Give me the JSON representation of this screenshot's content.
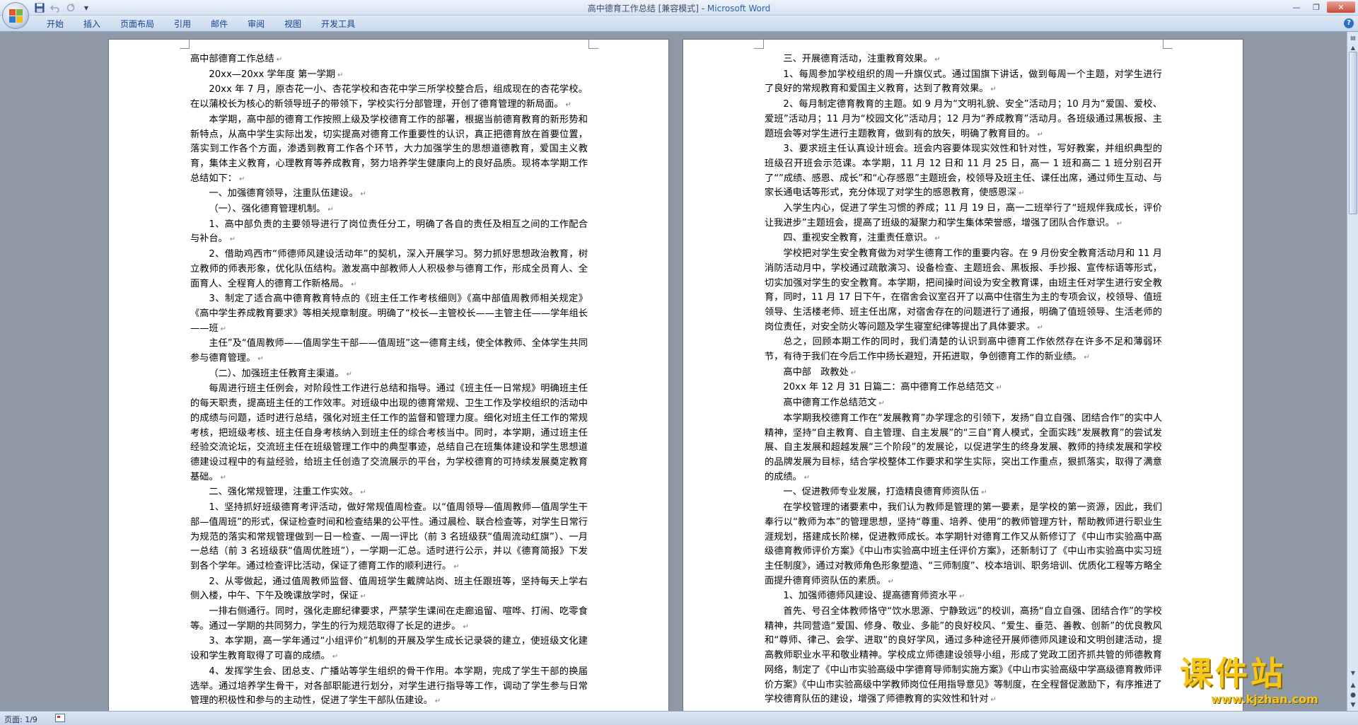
{
  "window": {
    "title": "高中德育工作总结 [兼容模式] - ",
    "app_name": "Microsoft Word"
  },
  "quick_access": [
    "save-icon",
    "undo-icon",
    "redo-icon",
    "customize-dropdown-icon"
  ],
  "ribbon": {
    "tabs": [
      "开始",
      "插入",
      "页面布局",
      "引用",
      "邮件",
      "审阅",
      "视图",
      "开发工具"
    ]
  },
  "status": {
    "page": "页面: 1/9"
  },
  "watermark": {
    "title": "课件站",
    "url": "www.kjzhan.com"
  },
  "left_page": [
    {
      "text": "高中部德育工作总结",
      "indent": false
    },
    {
      "text": "20xx—20xx 学年度 第一学期",
      "indent": true
    },
    {
      "text": "20xx 年 7 月，原杏花一小、杏花学校和杏花中学三所学校整合后，组成现在的杏花学校。在以蒲校长为核心的新领导班子的带领下，学校实行分部管理，开创了德育管理的新局面。",
      "indent": true
    },
    {
      "text": "本学期，高中部的德育工作按照上级及学校德育工作的部署，根据当前德育教育的新形势和新特点，从高中学生实际出发，切实提高对德育工作重要性的认识，真正把德育放在首要位置，落实到工作各个方面，渗透到教育工作各个环节，大力加强学生的思想道德教育，爱国主义教育，集体主义教育，心理教育等养成教育，努力培养学生健康向上的良好品质。现将本学期工作总结如下：",
      "indent": true
    },
    {
      "text": "一、加强德育领导，注重队伍建设。",
      "indent": true
    },
    {
      "text": "（一）、强化德育管理机制。",
      "indent": true
    },
    {
      "text": "1、高中部负责的主要领导进行了岗位责任分工，明确了各自的责任及相互之间的工作配合与补台。",
      "indent": true
    },
    {
      "text": "2、借助鸡西市“师德师风建设活动年”的契机，深入开展学习。努力抓好思想政治教育，树立教师的师表形象，优化队伍结构。激发高中部教师人人积极参与德育工作，形成全员育人、全面育人、全程育人的德育工作新格局。",
      "indent": true
    },
    {
      "text": "3、制定了适合高中德育教育特点的《班主任工作考核细则》《高中部值周教师相关规定》《高中学生养成教育要求》等相关规章制度。明确了“校长—主管校长——主管主任——学年组长——班",
      "indent": true
    },
    {
      "text": "主任”及“值周教师——值周学生干部——值周班”这一德育主线，使全体教师、全体学生共同参与德育管理。",
      "indent": true
    },
    {
      "text": "（二）、加强班主任教育主渠道。",
      "indent": true
    },
    {
      "text": "每周进行班主任例会，对阶段性工作进行总结和指导。通过《班主任一日常规》明确班主任的每天职责，提高班主任的工作效率。对班级中出现的德育常规、卫生工作及学校组织的活动中的成绩与问题，适时进行总结，强化对班主任工作的监督和管理力度。细化对班主任工作的常规考核，把班级考核、班主任自身考核纳入到班主任的综合考核当中。同时，本学期，通过班主任经验交流论坛，交流班主任在班级管理工作中的典型事迹，总结自己在班集体建设和学生思想道德建设过程中的有益经验，给班主任创造了交流展示的平台，为学校德育的可持续发展奠定教育基础。",
      "indent": true
    },
    {
      "text": "二、强化常规管理，注重工作实效。",
      "indent": true
    },
    {
      "text": "1、坚持抓好班级德育考评活动，做好常规值周检查。以“值周领导—值周教师—值周学生干部—值周班”的形式，保证检查时间和检查结果的公平性。通过晨检、联合检查等，对学生日常行为规范的落实和常规管理做到一日一检查、一周一评比（前 3 名班级获“值周流动红旗”）、一月一总结（前 3 名班级获“值周优胜班”），一学期一汇总。适时进行公示，并以《德育简报》下发到各个学年。通过检查评比活动，保证了德育工作的顺利进行。",
      "indent": true
    },
    {
      "text": "2、从零做起，通过值周教师监督、值周班学生戴牌站岗、班主任跟班等，坚持每天上学右侧入楼，中午、下午及晚课放学时，保证",
      "indent": true
    },
    {
      "text": "一排右侧通行。同时，强化走廊纪律要求，严禁学生课间在走廊追留、喧哗、打闹、吃零食等。通过一学期的共同努力，学生的行为规范取得了长足的进步。",
      "indent": true
    },
    {
      "text": "3、本学期，高一学年通过“小组评价”机制的开展及学生成长记录袋的建立，使班级文化建设和学生教育取得了可喜的成绩。",
      "indent": true
    },
    {
      "text": "4、发挥学生会、团总支、广播站等学生组织的骨干作用。本学期，完成了学生干部的换届选举。通过培养学生骨干，对各部职能进行划分，对学生进行指导等工作，调动了学生参与日常管理的积极性和参与的主动性，促进了学生干部队伍建设。",
      "indent": true
    }
  ],
  "right_page": [
    {
      "text": "三、开展德育活动，注重教育效果。",
      "indent": true
    },
    {
      "text": "1、每周参加学校组织的周一升旗仪式。通过国旗下讲话，做到每周一个主题，对学生进行了良好的常规教育和爱国主义教育，达到了教育效果。",
      "indent": true
    },
    {
      "text": "2、每月制定德育教育的主题。如 9 月为“文明礼貌、安全”活动月；10 月为“爱国、爱校、爱班”活动月；11 月为“校园文化”活动月；12 月为“养成教育”活动月。各班级通过黑板报、主题班会等对学生进行主题教育，做到有的放矢，明确了教育目的。",
      "indent": true
    },
    {
      "text": "3、要求班主任认真设计班会。班会内容要体现实效性和针对性，写好教案，并组织典型的班级召开班会示范课。本学期，11 月 12 日和 11 月 25 日，高一 1 班和高二 1 班分别召开了“”成绩、感恩、成长”和“心存感恩”主题班会，校领导及班主任、课任出席，通过师生互动、与家长通电话等形式，充分体现了对学生的感恩教育，使感恩深",
      "indent": true
    },
    {
      "text": "入学生内心，促进了学生习惯的养成；11 月 19 日，高一二班举行了“班规伴我成长，评价让我进步”主题班会，提高了班级的凝聚力和学生集体荣誉感，增强了团队合作意识。",
      "indent": true
    },
    {
      "text": "四、重视安全教育，注重责任意识。",
      "indent": true
    },
    {
      "text": "学校把对学生安全教育做为对学生德育工作的重要内容。在 9 月份安全教育活动月和 11 月消防活动月中，学校通过疏散演习、设备检查、主题班会、黑板报、手抄报、宣传标语等形式，切实加强对学生的安全教育。本学期，把间操时间设为安全教育课，由班主任对学生进行安全教育，同时，11 月 17 日下午，在宿舍会议室召开了以高中住宿生为主的专项会议，校领导、值班领导、生活楼老师、班主任出席，对宿舍存在的问题进行了通报，明确了值班领导、生活老师的岗位责任，对安全防火等问题及学生寝室纪律等提出了具体要求。",
      "indent": true
    },
    {
      "text": "总之，回顾本期工作的同时，我们清楚的认识到高中德育工作依然存在许多不足和薄弱环节，有待于我们在今后工作中扬长避短，开拓进取，争创德育工作的新业绩。",
      "indent": true
    },
    {
      "text": "高中部　政教处",
      "indent": true
    },
    {
      "text": "20xx 年 12 月 31 日篇二：高中德育工作总结范文",
      "indent": true
    },
    {
      "text": "高中德育工作总结范文",
      "indent": true
    },
    {
      "text": "本学期我校德育工作在“发展教育”办学理念的引领下，发扬“自立自强、团结合作”的实中人精神，坚持“自主教育、自主管理、自主发展”的“三自”育人模式，全面实践“发展教育”的尝试发展、自主发展和超越发展“三个阶段”的发展论，以促进学生的终身发展、教师的持续发展和学校的品牌发展为目标，结合学校整体工作要求和学生实际，突出工作重点，狠抓落实，取得了满意的成绩。",
      "indent": true
    },
    {
      "text": "一、促进教师专业发展，打造精良德育师资队伍",
      "indent": true
    },
    {
      "text": "在学校管理的诸要素中，我们认为教师是管理的第一要素，是学校的第一资源，因此，我们奉行以“教师为本”的管理思想，坚持“尊重、培养、使用”的教师管理方针，帮助教师进行职业生涯规划，搭建成长阶梯，促进教师成长。本学期针对德育工作又从新修订了《中山市实验高中高级德育教师评价方案》《中山市实验高中班主任评价方案》，还新制订了《中山市实验高中实习班主任制度》，通过对教师角色形象塑造、“三师制度”、校本培训、职务培训、优质化工程等方略全面提升德育师资队伍的素质。",
      "indent": true
    },
    {
      "text": "1、加强师德师风建设、提高德育师资水平",
      "indent": true
    },
    {
      "text": "首先、号召全体教师恪守“饮水思源、宁静致远”的校训，高扬“自立自强、团结合作”的学校精神，共同营造“爱国、修身、敬业、多能”的良好校风、“爱生、垂范、善教、创新”的优良教风和“尊师、律己、会学、进取”的良好学风，通过多种途径开展师德师风建设和文明创建活动，提高教师职业水平和敬业精神。学校成立师德建设领导小组，形成了党政工团齐抓共管的师德教育网络，制定了《中山市实验高级中学德育导师制实施方案》《中山市实验高级中学高级德育教师评价方案》《中山市实验高级中学教师岗位任用指导意见》等制度，在全程督促激励下，有序推进了学校德育队伍的建设，增强了师德教育的实效性和针对",
      "indent": true
    }
  ]
}
